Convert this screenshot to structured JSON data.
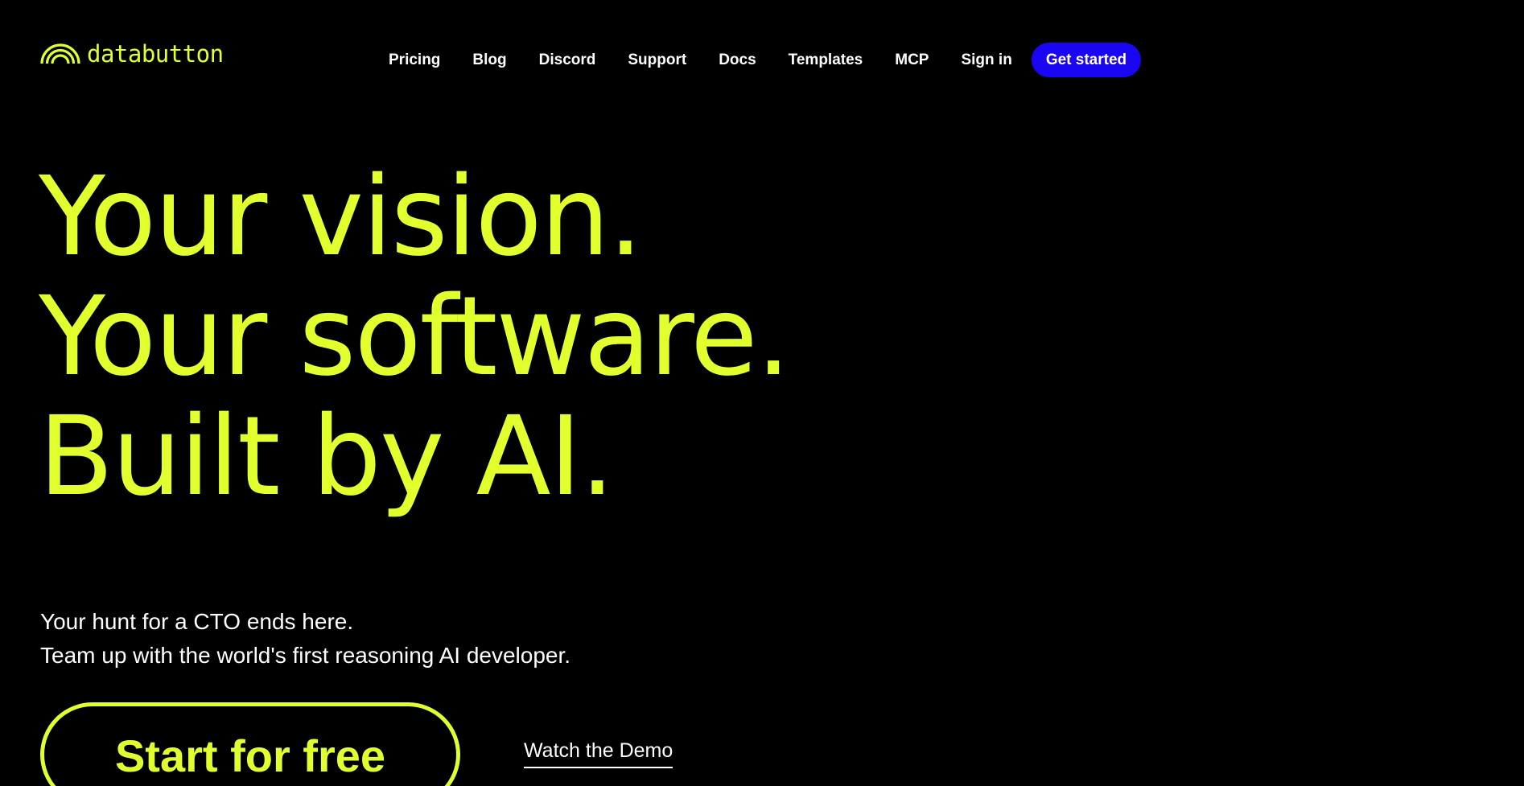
{
  "brand": {
    "name": "databutton",
    "logo_icon": "rainbow-arcs-icon",
    "accent_color": "#e2ff2e"
  },
  "nav": {
    "items": [
      {
        "label": "Pricing"
      },
      {
        "label": "Blog"
      },
      {
        "label": "Discord"
      },
      {
        "label": "Support"
      },
      {
        "label": "Docs"
      },
      {
        "label": "Templates"
      },
      {
        "label": "MCP"
      },
      {
        "label": "Sign in"
      }
    ],
    "cta": {
      "label": "Get started",
      "color": "#1a06f2"
    }
  },
  "hero": {
    "title_lines": [
      "Your vision.",
      "Your software.",
      "Built by AI."
    ],
    "subtitle_lines": [
      "Your hunt for a CTO ends here.",
      "Team up with the world's first reasoning AI developer."
    ],
    "primary_cta": "Start for free",
    "secondary_cta": "Watch the Demo"
  },
  "colors": {
    "background": "#000000",
    "text": "#ffffff"
  }
}
